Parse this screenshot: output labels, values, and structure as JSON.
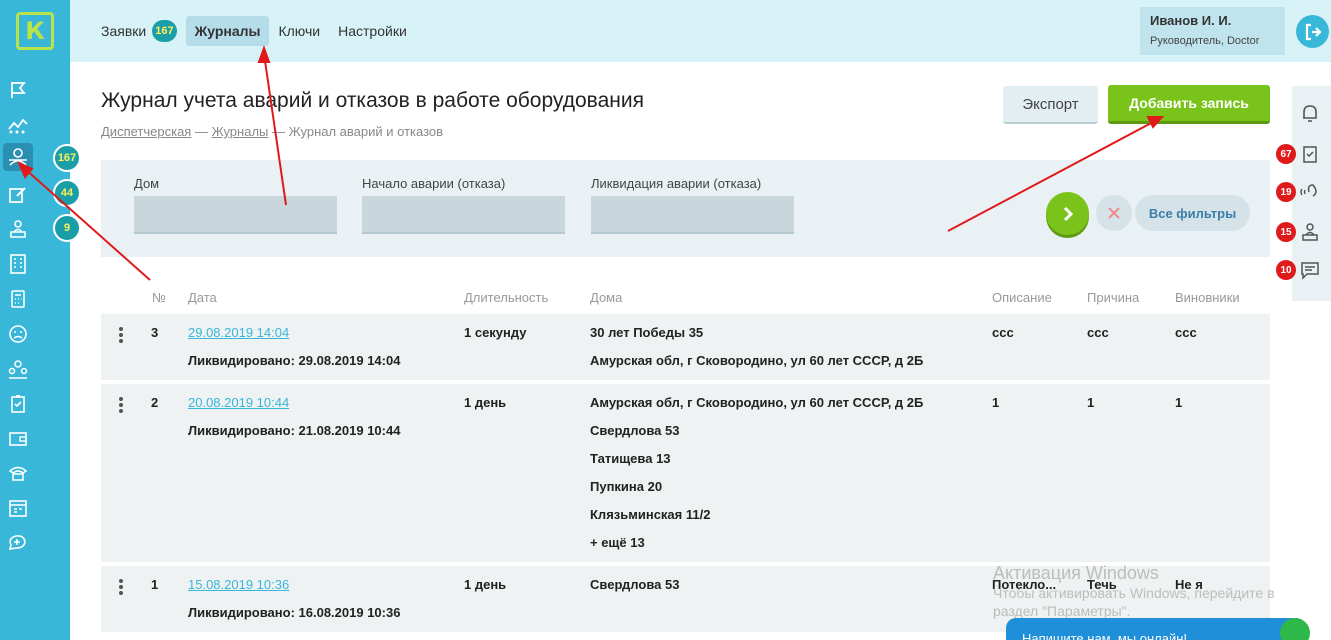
{
  "logo": {
    "letter": "К"
  },
  "topnav": [
    {
      "label": "Заявки",
      "badge": "167"
    },
    {
      "label": "Журналы",
      "active": true
    },
    {
      "label": "Ключи"
    },
    {
      "label": "Настройки"
    }
  ],
  "user": {
    "name": "Иванов И. И.",
    "role": "Руководитель, Doctor"
  },
  "sidebar": {
    "badges": [
      "167",
      "44",
      "9"
    ]
  },
  "page": {
    "title": "Журнал учета аварий и отказов в работе оборудования",
    "breadcrumb": [
      "Диспетчерская",
      "Журналы",
      "Журнал аварий и отказов"
    ],
    "export_label": "Экспорт",
    "add_label": "Добавить запись"
  },
  "filters": {
    "house_label": "Дом",
    "start_label": "Начало аварии (отказа)",
    "end_label": "Ликвидация аварии (отказа)",
    "all_filters": "Все фильтры"
  },
  "table": {
    "headers": [
      "№",
      "Дата",
      "Длительность",
      "Дома",
      "Описание",
      "Причина",
      "Виновники"
    ],
    "rows": [
      {
        "num": "3",
        "date": "29.08.2019 14:04",
        "liquidated": "Ликвидировано: 29.08.2019 14:04",
        "duration": "1 секунду",
        "houses": [
          "30 лет Победы 35",
          "Амурская обл, г Сковородино, ул 60 лет СССР, д 2Б"
        ],
        "description": "ссс",
        "reason": "ссс",
        "culprits": "ссс"
      },
      {
        "num": "2",
        "date": "20.08.2019 10:44",
        "liquidated": "Ликвидировано: 21.08.2019 10:44",
        "duration": "1 день",
        "houses": [
          "Амурская обл, г Сковородино, ул 60 лет СССР, д 2Б",
          "Свердлова 53",
          "Татищева 13",
          "Пупкина 20",
          "Клязьминская 11/2",
          "+ ещё 13"
        ],
        "description": "1",
        "reason": "1",
        "culprits": "1"
      },
      {
        "num": "1",
        "date": "15.08.2019 10:36",
        "liquidated": "Ликвидировано: 16.08.2019 10:36",
        "duration": "1 день",
        "houses": [
          "Свердлова 53"
        ],
        "description": "Потекло...",
        "reason": "Течь",
        "culprits": "Не я"
      }
    ]
  },
  "right_badges": [
    "67",
    "19",
    "15",
    "10"
  ],
  "windows": {
    "line1": "Активация Windows",
    "line2": "Чтобы активировать Windows, перейдите в",
    "line3": "раздел \"Параметры\"."
  },
  "chat": {
    "label": "Напишите нам, мы онлайн!"
  },
  "colors": {
    "accent": "#39b7d9",
    "green": "#7ac31a",
    "badge_red": "#e01a1a",
    "badge_teal": "#1a9fa8"
  }
}
